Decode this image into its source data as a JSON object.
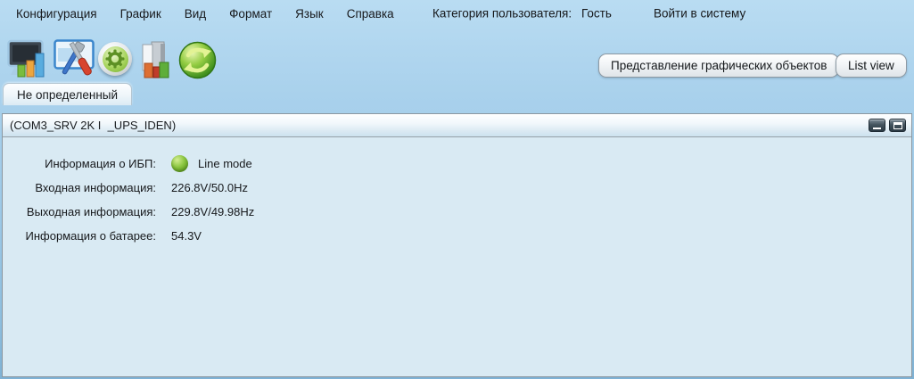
{
  "menu": {
    "items": [
      "Конфигурация",
      "График",
      "Вид",
      "Формат",
      "Язык",
      "Справка"
    ]
  },
  "user_area": {
    "category_label": "Категория пользователя:",
    "category_value": "Гость",
    "login_text": "Войти в систему"
  },
  "toolbar": {
    "icons": [
      {
        "name": "monitor-status-icon"
      },
      {
        "name": "settings-tools-icon"
      },
      {
        "name": "gear-icon"
      },
      {
        "name": "logs-data-icon"
      },
      {
        "name": "refresh-icon"
      }
    ],
    "graphic_view_button": "Представление графических объектов",
    "list_view_button": "List view"
  },
  "tabs": {
    "active_label": "Не определенный"
  },
  "panel": {
    "title": "(COM3_SRV 2K I  _UPS_IDEN)"
  },
  "ups_info": {
    "rows": [
      {
        "label": "Информация о ИБП:",
        "value": "Line mode"
      },
      {
        "label": "Входная информация:",
        "value": "226.8V/50.0Hz"
      },
      {
        "label": "Выходная информация:",
        "value": "229.8V/49.98Hz"
      },
      {
        "label": "Информация о батарее:",
        "value": "54.3V"
      }
    ]
  },
  "colors": {
    "status_green": "#6fb52c",
    "background_blue": "#9dc9e7",
    "panel_content": "#d9eaf3"
  }
}
